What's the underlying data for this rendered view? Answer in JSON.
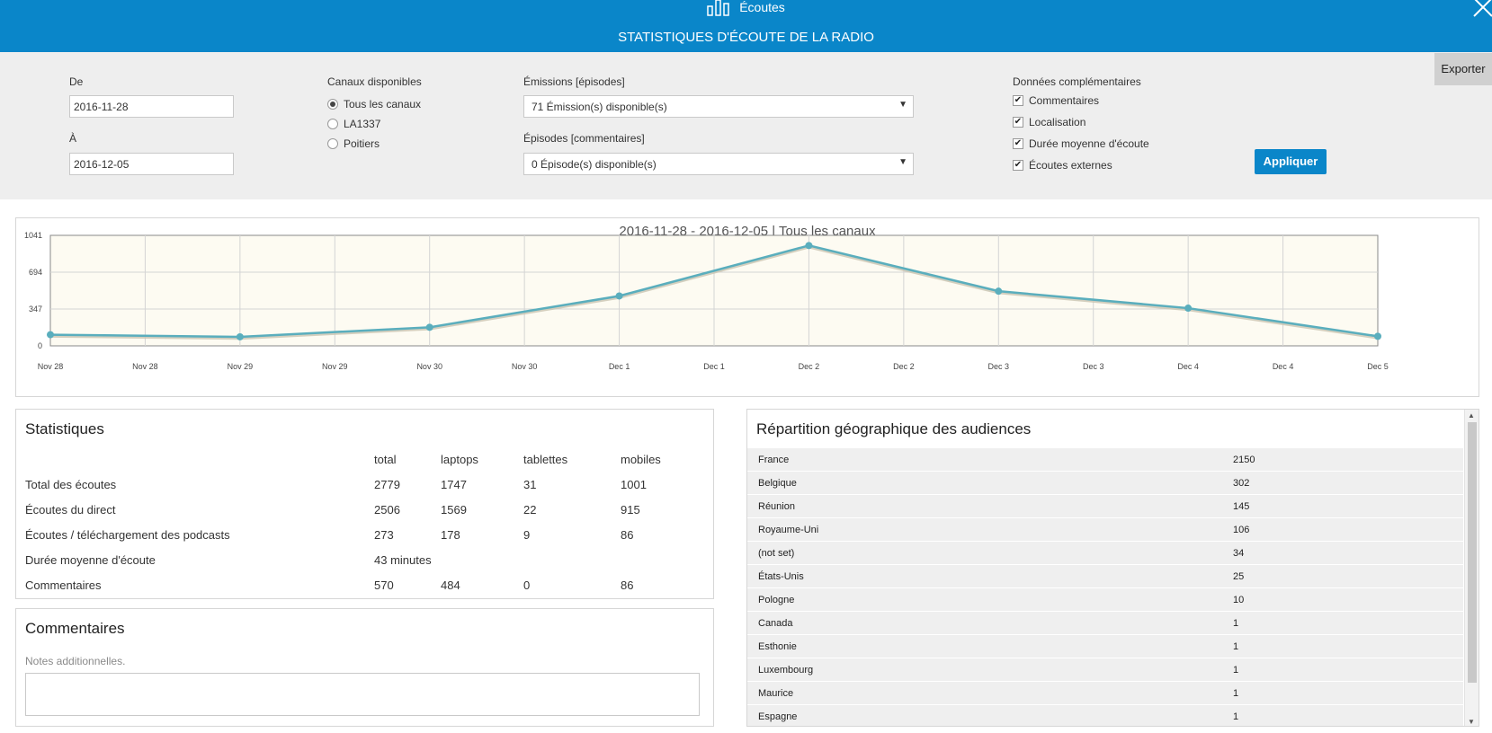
{
  "header": {
    "app_name": "Écoutes",
    "page_title": "STATISTIQUES D'ÉCOUTE DE LA RADIO"
  },
  "filters": {
    "from_label": "De",
    "from_value": "2016-11-28",
    "to_label": "À",
    "to_value": "2016-12-05",
    "channels_label": "Canaux disponibles",
    "channels": [
      {
        "label": "Tous les canaux",
        "selected": true
      },
      {
        "label": "LA1337",
        "selected": false
      },
      {
        "label": "Poitiers",
        "selected": false
      }
    ],
    "emissions_label": "Émissions [épisodes]",
    "emissions_value": "71 Émission(s) disponible(s)",
    "episodes_label": "Épisodes [commentaires]",
    "episodes_value": "0 Épisode(s) disponible(s)",
    "extra_label": "Données complémentaires",
    "extras": [
      {
        "label": "Commentaires",
        "checked": true
      },
      {
        "label": "Localisation",
        "checked": true
      },
      {
        "label": "Durée moyenne d'écoute",
        "checked": true
      },
      {
        "label": "Écoutes externes",
        "checked": true
      }
    ],
    "apply_label": "Appliquer",
    "export_label": "Exporter"
  },
  "chart_data": {
    "type": "line",
    "title": "2016-11-28 - 2016-12-05 | Tous les canaux",
    "x": [
      "Nov 28",
      "Nov 29",
      "Nov 30",
      "Dec 1",
      "Dec 2",
      "Dec 3",
      "Dec 4",
      "Dec 5"
    ],
    "x_tick_labels": [
      "Nov 28",
      "Nov 28",
      "Nov 29",
      "Nov 29",
      "Nov 30",
      "Nov 30",
      "Dec 1",
      "Dec 1",
      "Dec 2",
      "Dec 2",
      "Dec 3",
      "Dec 3",
      "Dec 4",
      "Dec 4",
      "Dec 5"
    ],
    "series": [
      {
        "values": [
          105,
          85,
          175,
          470,
          945,
          515,
          355,
          90
        ]
      }
    ],
    "y_ticks": [
      0,
      347,
      694,
      1041
    ],
    "ylim": [
      0,
      1041
    ],
    "grid": true,
    "colors": {
      "line": "#5aaebd",
      "background": "#fdfbf2"
    }
  },
  "stats": {
    "title": "Statistiques",
    "columns": [
      "total",
      "laptops",
      "tablettes",
      "mobiles"
    ],
    "rows": [
      {
        "label": "Total des écoutes",
        "values": [
          "2779",
          "1747",
          "31",
          "1001"
        ]
      },
      {
        "label": "Écoutes du direct",
        "values": [
          "2506",
          "1569",
          "22",
          "915"
        ]
      },
      {
        "label": "Écoutes / téléchargement des podcasts",
        "values": [
          "273",
          "178",
          "9",
          "86"
        ]
      },
      {
        "label": "Durée moyenne d'écoute",
        "values": [
          "43 minutes",
          "",
          "",
          ""
        ]
      },
      {
        "label": "Commentaires",
        "values": [
          "570",
          "484",
          "0",
          "86"
        ]
      }
    ]
  },
  "comments": {
    "title": "Commentaires",
    "subtitle": "Notes additionnelles."
  },
  "geo": {
    "title": "Répartition géographique des audiences",
    "rows": [
      {
        "country": "France",
        "value": "2150"
      },
      {
        "country": "Belgique",
        "value": "302"
      },
      {
        "country": "Réunion",
        "value": "145"
      },
      {
        "country": "Royaume-Uni",
        "value": "106"
      },
      {
        "country": "(not set)",
        "value": "34"
      },
      {
        "country": "États-Unis",
        "value": "25"
      },
      {
        "country": "Pologne",
        "value": "10"
      },
      {
        "country": "Canada",
        "value": "1"
      },
      {
        "country": "Esthonie",
        "value": "1"
      },
      {
        "country": "Luxembourg",
        "value": "1"
      },
      {
        "country": "Maurice",
        "value": "1"
      },
      {
        "country": "Espagne",
        "value": "1"
      }
    ]
  }
}
